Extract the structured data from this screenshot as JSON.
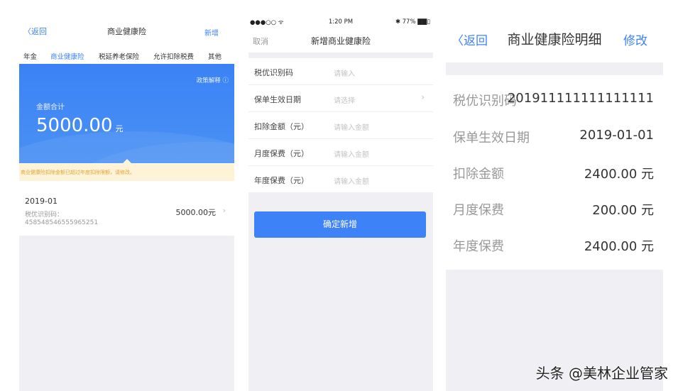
{
  "panel1": {
    "back_label": "返回",
    "title": "商业健康险",
    "new_label": "新增",
    "tabs": [
      {
        "label": "年金",
        "active": false
      },
      {
        "label": "商业健康险",
        "active": true
      },
      {
        "label": "税延养老保险",
        "active": false
      },
      {
        "label": "允许扣除税费",
        "active": false
      },
      {
        "label": "其他",
        "active": false
      }
    ],
    "policy_label": "政策解释 ⓘ",
    "total_label": "金额合计",
    "total_amount": "5000.00",
    "total_unit": "元",
    "notice": "商业健康险扣除金额已超过年度扣除限额，请修改。",
    "item": {
      "date": "2019-01",
      "id_label": "税优识别码：",
      "id_value": "458548546555965251",
      "amount": "5000.00元",
      "chevron": "›"
    }
  },
  "panel2": {
    "status": {
      "signal": "●●●○○ ᯤ",
      "time": "1:20 PM",
      "battery": "✱ 77% ▇▇▯"
    },
    "cancel_label": "取消",
    "title": "新增商业健康险",
    "rows": [
      {
        "label": "税优识别码",
        "placeholder": "请输入"
      },
      {
        "label": "保单生效日期",
        "placeholder": "请选择",
        "chevron": "›"
      },
      {
        "label": "扣除金额（元）",
        "placeholder": "请输入金额"
      },
      {
        "label": "月度保费（元）",
        "placeholder": "请输入金额"
      },
      {
        "label": "年度保费（元）",
        "placeholder": "请输入金额"
      }
    ],
    "confirm_label": "确定新增"
  },
  "panel3": {
    "back_label": "〈返回",
    "title": "商业健康险明细",
    "edit_label": "修改",
    "rows": [
      {
        "label": "税优识别码",
        "value": "201911111111111111"
      },
      {
        "label": "保单生效日期",
        "value": "2019-01-01"
      },
      {
        "label": "扣除金额",
        "value": "2400.00 元"
      },
      {
        "label": "月度保费",
        "value": "200.00 元"
      },
      {
        "label": "年度保费",
        "value": "2400.00 元"
      }
    ]
  },
  "watermark": "头条 @美林企业管家",
  "colors": {
    "accent": "#3e82f7",
    "notice_bg": "#fdf3d7",
    "notice_text": "#e2a43c",
    "page_gray": "#efeff4"
  }
}
